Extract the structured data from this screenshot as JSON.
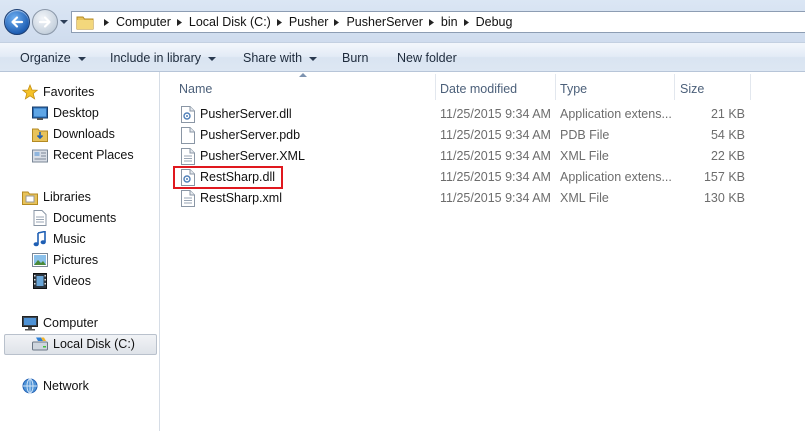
{
  "breadcrumb": [
    "Computer",
    "Local Disk (C:)",
    "Pusher",
    "PusherServer",
    "bin",
    "Debug"
  ],
  "toolbar": {
    "organize": "Organize",
    "include_in_library": "Include in library",
    "share_with": "Share with",
    "burn": "Burn",
    "new_folder": "New folder"
  },
  "nav": {
    "favorites": "Favorites",
    "desktop": "Desktop",
    "downloads": "Downloads",
    "recent_places": "Recent Places",
    "libraries": "Libraries",
    "documents": "Documents",
    "music": "Music",
    "pictures": "Pictures",
    "videos": "Videos",
    "computer": "Computer",
    "local_disk": "Local Disk (C:)",
    "network": "Network"
  },
  "columns": {
    "name": "Name",
    "date_modified": "Date modified",
    "type": "Type",
    "size": "Size"
  },
  "files": [
    {
      "name": "PusherServer.dll",
      "date": "11/25/2015 9:34 AM",
      "type": "Application extens...",
      "size": "21 KB",
      "icon": "dll-icon"
    },
    {
      "name": "PusherServer.pdb",
      "date": "11/25/2015 9:34 AM",
      "type": "PDB File",
      "size": "54 KB",
      "icon": "blank-file-icon"
    },
    {
      "name": "PusherServer.XML",
      "date": "11/25/2015 9:34 AM",
      "type": "XML File",
      "size": "22 KB",
      "icon": "xml-file-icon"
    },
    {
      "name": "RestSharp.dll",
      "date": "11/25/2015 9:34 AM",
      "type": "Application extens...",
      "size": "157 KB",
      "icon": "dll-icon"
    },
    {
      "name": "RestSharp.xml",
      "date": "11/25/2015 9:34 AM",
      "type": "XML File",
      "size": "130 KB",
      "icon": "xml-file-icon"
    }
  ],
  "colors": {
    "highlight_box": "#e0181e",
    "header_text": "#4c607a",
    "secondary_text": "#6d6d6d"
  }
}
